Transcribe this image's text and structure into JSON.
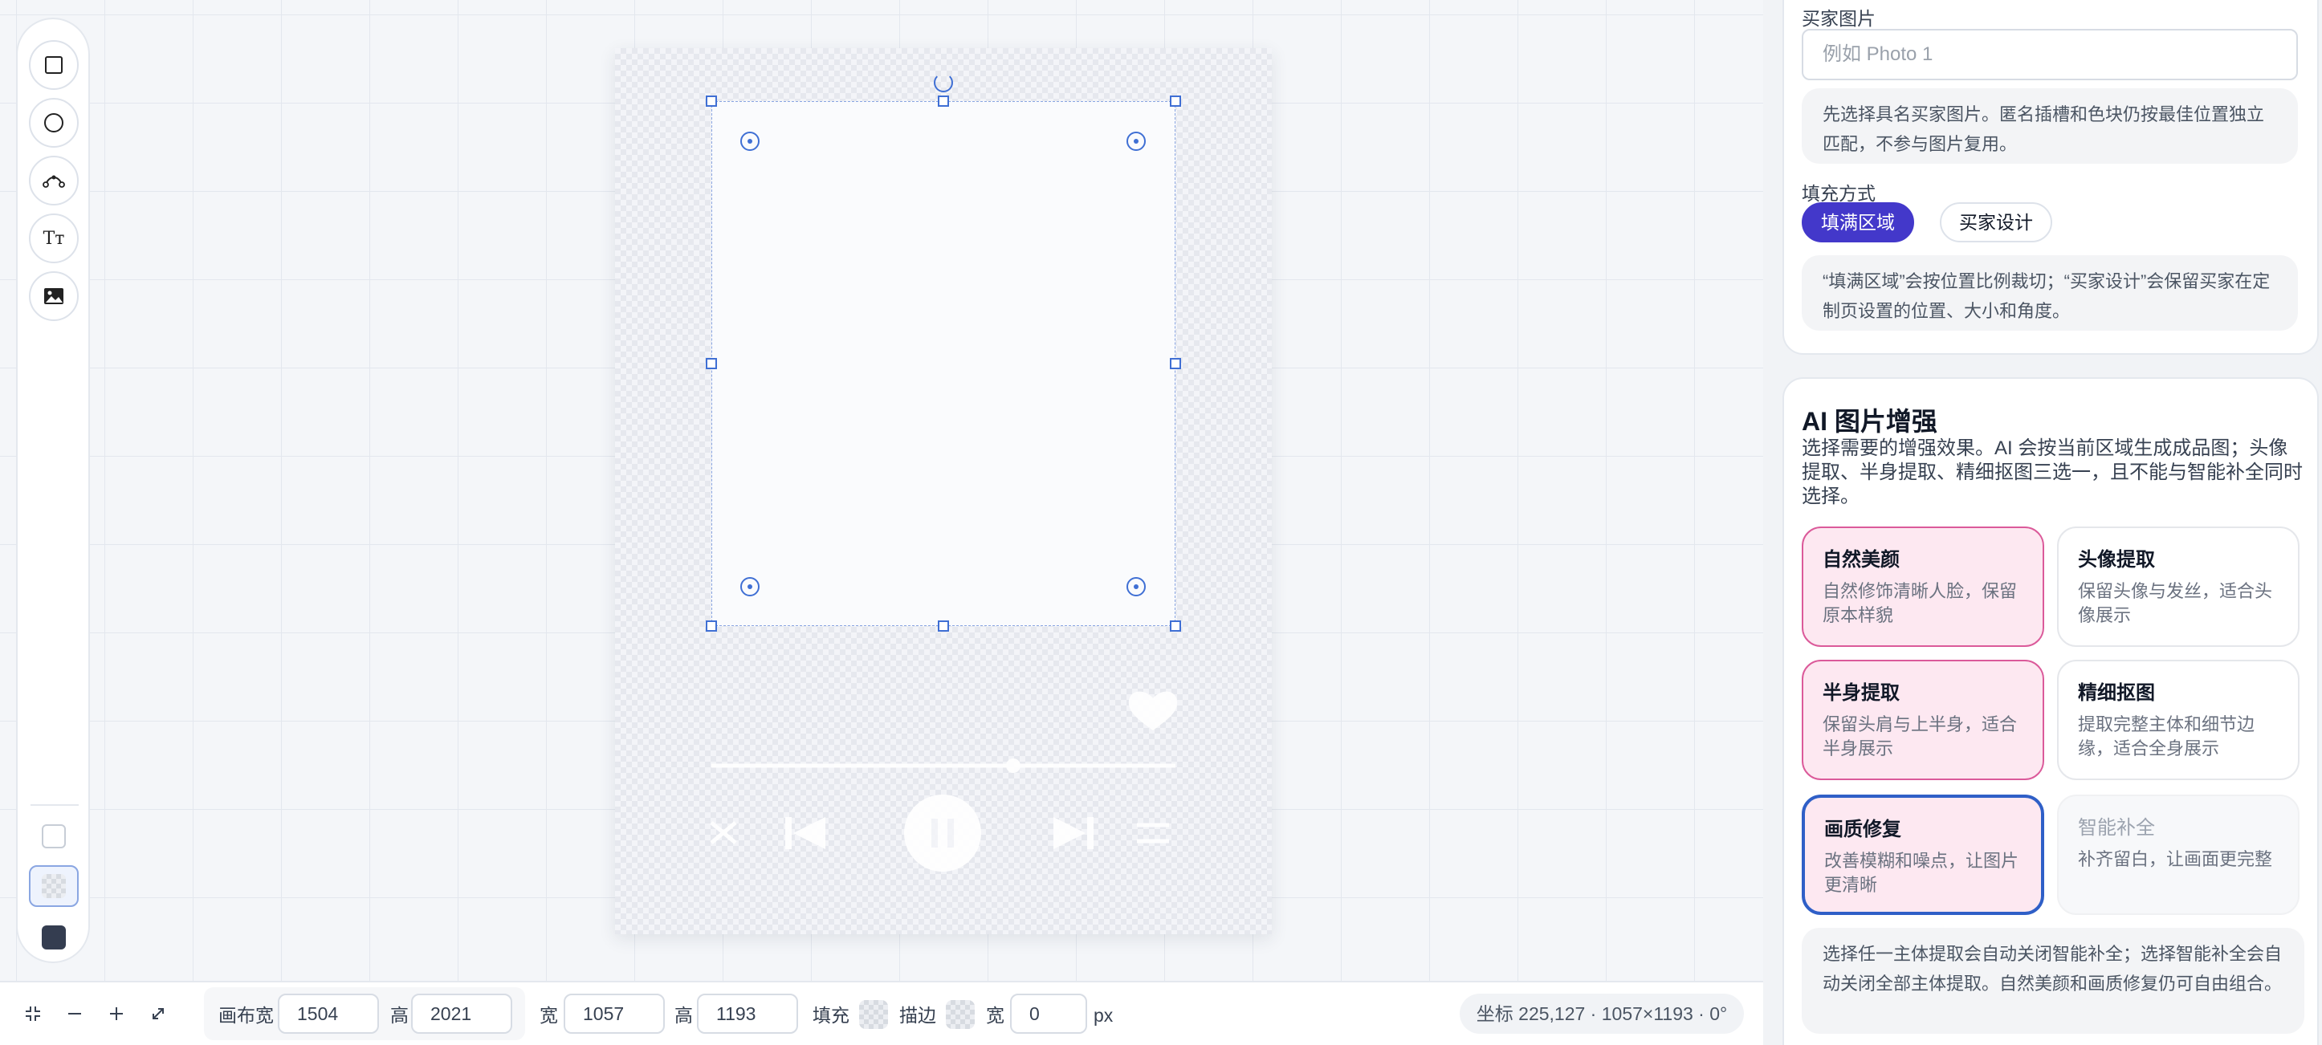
{
  "toolbar": {
    "tools": [
      {
        "name": "rectangle-tool",
        "icon": "square-icon"
      },
      {
        "name": "ellipse-tool",
        "icon": "circle-icon"
      },
      {
        "name": "pen-tool",
        "icon": "bezier-icon"
      },
      {
        "name": "text-tool",
        "icon": "text-icon",
        "glyph": "Tт"
      },
      {
        "name": "image-tool",
        "icon": "image-icon"
      }
    ],
    "fill_color": "#343d50"
  },
  "bottom_bar": {
    "canvas_width_label": "画布宽",
    "canvas_width": "1504",
    "canvas_height_label": "高",
    "canvas_height": "2021",
    "width_label": "宽",
    "width": "1057",
    "height_label": "高",
    "height": "1193",
    "fill_label": "填充",
    "stroke_label": "描边",
    "stroke_width_label": "宽",
    "stroke_width": "0",
    "unit": "px",
    "status": "坐标 225,127 · 1057×1193 · 0°"
  },
  "panel": {
    "buyer_image": {
      "label": "买家图片",
      "placeholder": "例如 Photo 1",
      "note": "先选择具名买家图片。匿名插槽和色块仍按最佳位置独立匹配，不参与图片复用。"
    },
    "fill_mode": {
      "label": "填充方式",
      "options": [
        "填满区域",
        "买家设计"
      ],
      "active": "填满区域",
      "note": "“填满区域”会按位置比例裁切；“买家设计”会保留买家在定制页设置的位置、大小和角度。"
    },
    "ai": {
      "title": "AI 图片增强",
      "description": "选择需要的增强效果。AI 会按当前区域生成成品图；头像提取、半身提取、精细抠图三选一，且不能与智能补全同时选择。",
      "options": [
        {
          "title": "自然美颜",
          "desc": "自然修饰清晰人脸，保留原本样貌",
          "state": "selected"
        },
        {
          "title": "头像提取",
          "desc": "保留头像与发丝，适合头像展示",
          "state": "default"
        },
        {
          "title": "半身提取",
          "desc": "保留头肩与上半身，适合半身展示",
          "state": "selected"
        },
        {
          "title": "精细抠图",
          "desc": "提取完整主体和细节边缘，适合全身展示",
          "state": "default"
        },
        {
          "title": "画质修复",
          "desc": "改善模糊和噪点，让图片更清晰",
          "state": "focused"
        },
        {
          "title": "智能补全",
          "desc": "补齐留白，让画面更完整",
          "state": "disabled"
        }
      ],
      "note": "选择任一主体提取会自动关闭智能补全；选择智能补全会自动关闭全部主体提取。自然美颜和画质修复仍可自由组合。"
    }
  },
  "colors": {
    "accent": "#4338ca",
    "selection": "#3f6fd4",
    "selected_card_bg": "#fde8f1",
    "selected_card_border": "#db5a9a",
    "focused_card_border": "#2f5fc7"
  }
}
